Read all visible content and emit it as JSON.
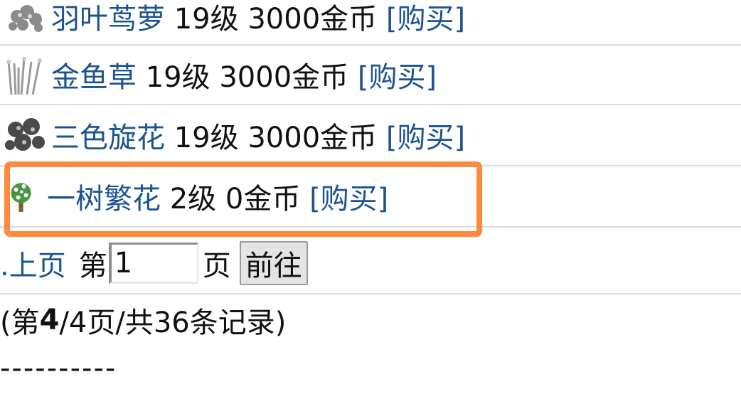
{
  "items": [
    {
      "name": "羽叶茑萝",
      "level": "19级",
      "price": "3000金币",
      "buy": "[购买]",
      "icon": "fern-vine-plant-icon"
    },
    {
      "name": "金鱼草",
      "level": "19级",
      "price": "3000金币",
      "buy": "[购买]",
      "icon": "snapdragon-plant-icon"
    },
    {
      "name": "三色旋花",
      "level": "19级",
      "price": "3000金币",
      "buy": "[购买]",
      "icon": "tricolor-morning-glory-plant-icon"
    },
    {
      "name": "一树繁花",
      "level": "2级",
      "price": "0金币",
      "buy": "[购买]",
      "icon": "flowering-tree-icon"
    }
  ],
  "pager": {
    "prev": ".上页",
    "page_prefix": "第",
    "page_value": "1",
    "page_suffix": "页",
    "go_button": "前往"
  },
  "summary": {
    "open": "(第",
    "current": "4",
    "rest": "/4页/共36条记录)"
  },
  "divider_text": "----------",
  "colors": {
    "link": "#1b5490",
    "highlight": "#ff8a3d",
    "separator": "#dcdcdc"
  }
}
